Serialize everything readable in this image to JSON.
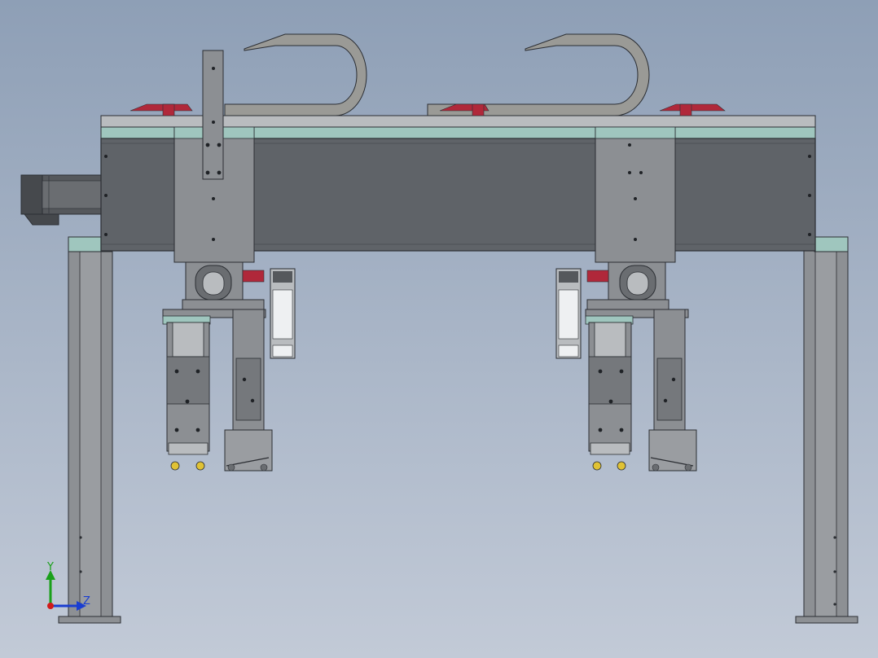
{
  "viewport": {
    "background_top": "#8e9fb6",
    "background_bottom": "#c2cad7"
  },
  "colors": {
    "beam": "#5f6368",
    "beam_edge": "#2b2e33",
    "metal": "#8c8f93",
    "metal_dark": "#55585c",
    "metal_light": "#b9bcbf",
    "accent_teal": "#9fc6be",
    "cable_red": "#b0283a",
    "cable_chain": "#9a9a96",
    "suction_yellow": "#e0c234",
    "axis_x": "#d11a1a",
    "axis_y": "#1aa01a",
    "axis_z": "#1a3ed1"
  },
  "triad": {
    "y_label": "Y",
    "z_label": "Z"
  }
}
